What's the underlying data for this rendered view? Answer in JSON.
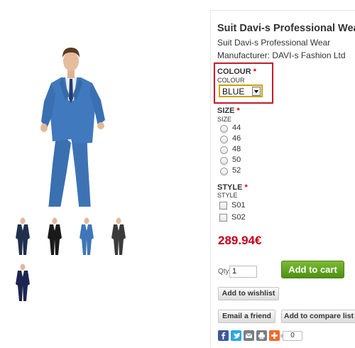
{
  "product": {
    "title": "Suit Davi-s Professional Wear",
    "subtitle": "Suit Davi-s Professional Wear",
    "manufacturer": "Manufacturer: DAVI-s Fashion Ltd",
    "price": "289.94€"
  },
  "colour": {
    "title": "COLOUR",
    "required_mark": "*",
    "sub": "COLOUR",
    "selected": "BLUE"
  },
  "size": {
    "title": "SIZE",
    "required_mark": "*",
    "sub": "SIZE",
    "options": [
      "44",
      "46",
      "48",
      "50",
      "52"
    ]
  },
  "style": {
    "title": "STYLE",
    "required_mark": "*",
    "sub": "STYLE",
    "options": [
      "S01",
      "S02"
    ]
  },
  "cart": {
    "qty_label": "Qty:",
    "qty_value": "1",
    "add_to_cart": "Add to cart"
  },
  "actions": {
    "wishlist": "Add to wishlist",
    "email": "Email a friend",
    "compare": "Add to compare list"
  },
  "share": {
    "count": "0",
    "icons": [
      "facebook-icon",
      "twitter-icon",
      "email-share-icon",
      "print-icon",
      "plus-share-icon"
    ]
  },
  "colors": {
    "suit_blue": "#3f76b8",
    "price_red": "#c3001c",
    "cart_green": "#5a9c1c",
    "highlight_red": "#c41e2b"
  }
}
